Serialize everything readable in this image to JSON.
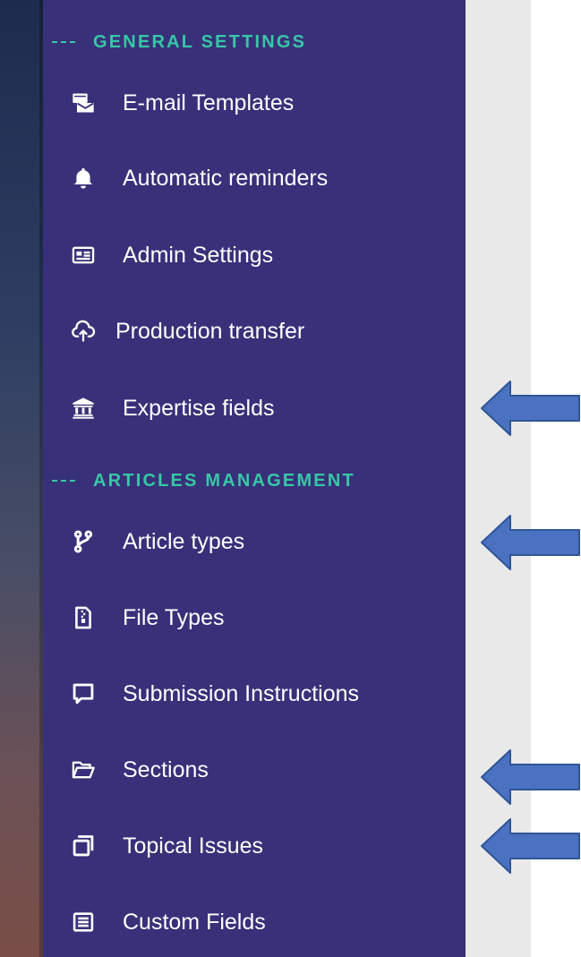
{
  "colors": {
    "sidebar_bg": "#383079",
    "heading_accent": "#37c7a6",
    "item_text": "#ffffff",
    "arrow_fill": "#4a72c0",
    "arrow_stroke": "#2f5597",
    "gutter_bg": "#e9e9e9"
  },
  "sidebar": {
    "sections": [
      {
        "heading": "GENERAL SETTINGS",
        "items": [
          {
            "label": "E-mail Templates",
            "icon": "email-templates-icon"
          },
          {
            "label": "Automatic reminders",
            "icon": "bell-icon"
          },
          {
            "label": "Admin Settings",
            "icon": "id-card-icon"
          },
          {
            "label": "Production transfer",
            "icon": "cloud-upload-icon"
          },
          {
            "label": "Expertise fields",
            "icon": "institution-icon"
          }
        ]
      },
      {
        "heading": "ARTICLES MANAGEMENT",
        "items": [
          {
            "label": "Article types",
            "icon": "branch-icon"
          },
          {
            "label": "File Types",
            "icon": "file-zip-icon"
          },
          {
            "label": "Submission Instructions",
            "icon": "chat-bubble-icon"
          },
          {
            "label": "Sections",
            "icon": "folder-open-icon"
          },
          {
            "label": "Topical Issues",
            "icon": "copy-icon"
          },
          {
            "label": "Custom Fields",
            "icon": "list-icon"
          }
        ]
      }
    ]
  },
  "annotations": {
    "arrows_point_to": [
      "Expertise fields",
      "Article types",
      "Sections",
      "Topical Issues"
    ]
  }
}
